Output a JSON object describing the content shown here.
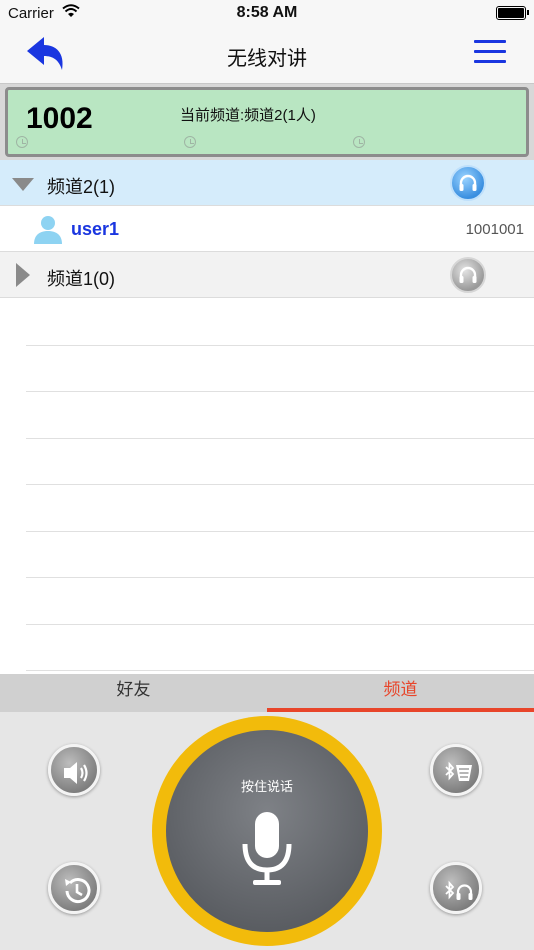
{
  "status_bar": {
    "carrier": "Carrier",
    "time": "8:58 AM"
  },
  "nav": {
    "title": "无线对讲",
    "back_icon": "back-arrow-icon",
    "menu_icon": "hamburger-menu-icon"
  },
  "status_panel": {
    "number": "1002",
    "current_channel": "当前频道:频道2(1人)"
  },
  "channels": [
    {
      "label": "频道2(1)",
      "expanded": true,
      "active": true,
      "members": [
        {
          "name": "user1",
          "id": "1001001"
        }
      ]
    },
    {
      "label": "频道1(0)",
      "expanded": false,
      "active": false,
      "members": []
    }
  ],
  "tabs": [
    {
      "label": "好友",
      "selected": false
    },
    {
      "label": "频道",
      "selected": true
    }
  ],
  "controls": {
    "ptt_label": "按住说话",
    "accent_color": "#f2bb0b",
    "icons": [
      "speaker-icon",
      "bluetooth-speaker-icon",
      "history-icon",
      "bluetooth-headset-icon",
      "microphone-icon"
    ]
  },
  "colors": {
    "tab_active": "#e8452a",
    "nav_accent": "#1a36e0",
    "panel_bg": "#b9e6c2"
  }
}
